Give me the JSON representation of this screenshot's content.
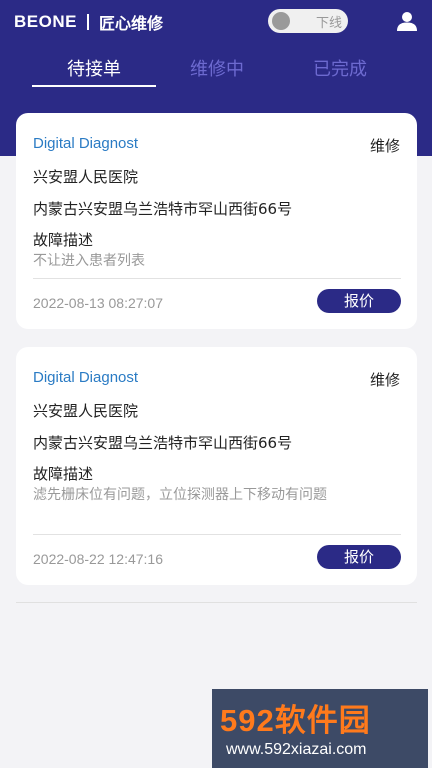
{
  "header": {
    "brand_logo": "BEONE",
    "brand_subtitle": "匠心维修",
    "online_toggle_label": "下线",
    "online": false
  },
  "tabs": [
    {
      "label": "待接单",
      "active": true
    },
    {
      "label": "维修中",
      "active": false
    },
    {
      "label": "已完成",
      "active": false
    }
  ],
  "orders": [
    {
      "device": "Digital Diagnost",
      "type": "维修",
      "hospital": "兴安盟人民医院",
      "address": "内蒙古兴安盟乌兰浩特市罕山西街66号",
      "fault_label": "故障描述",
      "fault_text": "不让进入患者列表",
      "time": "2022-08-13 08:27:07",
      "action": "报价"
    },
    {
      "device": "Digital Diagnost",
      "type": "维修",
      "hospital": "兴安盟人民医院",
      "address": "内蒙古兴安盟乌兰浩特市罕山西街66号",
      "fault_label": "故障描述",
      "fault_text": "滤先栅床位有问题，立位探测器上下移动有问题",
      "time": "2022-08-22 12:47:16",
      "action": "报价"
    }
  ],
  "watermark": {
    "title": "592软件园",
    "url": "www.592xiazai.com"
  },
  "colors": {
    "primary": "#2b2a86",
    "device_text": "#2a7bc4",
    "watermark_orange": "#ff7a1c"
  }
}
